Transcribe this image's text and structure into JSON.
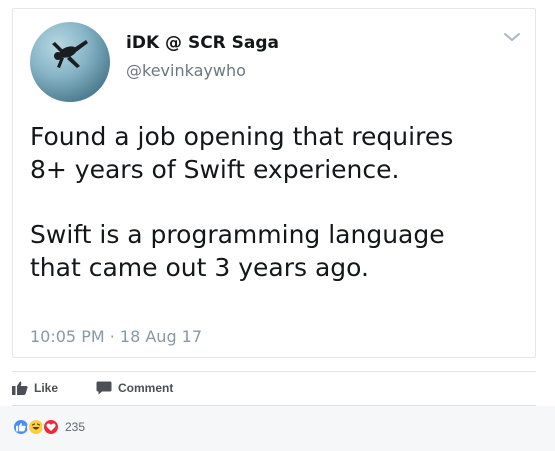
{
  "tweet": {
    "display_name": "iDK @ SCR Saga",
    "handle": "@kevinkaywho",
    "text_lines_1": [
      "Found a job opening that requires",
      "8+ years of Swift experience."
    ],
    "text_lines_2": [
      "Swift is a programming language",
      "that came out 3 years ago."
    ],
    "timestamp": "10:05 PM · 18 Aug 17"
  },
  "actions": {
    "like_label": "Like",
    "comment_label": "Comment"
  },
  "reactions": {
    "count": "235",
    "types": [
      "like",
      "haha",
      "love"
    ]
  },
  "colors": {
    "like": "#4a8df8",
    "haha": "#fbcf44",
    "love": "#f0283e"
  }
}
